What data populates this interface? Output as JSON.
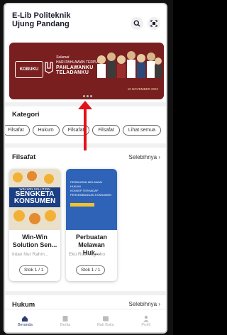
{
  "header": {
    "title_line1": "E-Lib Politeknik",
    "title_line2": "Ujung Pandang"
  },
  "banner": {
    "brand": "KOBUKU",
    "line_small": "Selamat",
    "line_top": "HARI PAHLAWAN TERPUJI",
    "line_main": "PAHLAWANKU",
    "line_main2": "TELADANKU",
    "date": "10 NOVEMBER 2022"
  },
  "kategori": {
    "title": "Kategori",
    "chips": [
      "Filsafat",
      "Hukum",
      "Filsafat",
      "Filsafat",
      "Lihat semua"
    ]
  },
  "filsafat": {
    "title": "Filsafat",
    "see_more": "Selebihnya",
    "books": [
      {
        "title": "Win-Win Solution Sen...",
        "author": "Intan Nur Rahm...",
        "stock": "Stok 1 / 1",
        "cover_line1": "WIN-WIN SOLUTION",
        "cover_line2": "SENGKETA",
        "cover_line3": "KONSUMEN"
      },
      {
        "title": "Perbuatan Melawan Huk...",
        "author": "Eko Rial Nugroho",
        "stock": "Stok 1 / 1",
        "cover_line1": "PERBUATAN MELAWAN HUKUM",
        "cover_line2": "KONSEP TERHADAP",
        "cover_line3": "PERKEMBANGAN KONSUMEN"
      }
    ]
  },
  "hukum": {
    "title": "Hukum",
    "see_more": "Selebihnya"
  },
  "nav": {
    "items": [
      {
        "label": "Beranda"
      },
      {
        "label": "Berita"
      },
      {
        "label": "Rak Buku"
      },
      {
        "label": "Profil"
      }
    ]
  },
  "colors": {
    "banner": "#7a1f1f",
    "arrow": "#e4111b",
    "accent": "#2a3f6e"
  }
}
